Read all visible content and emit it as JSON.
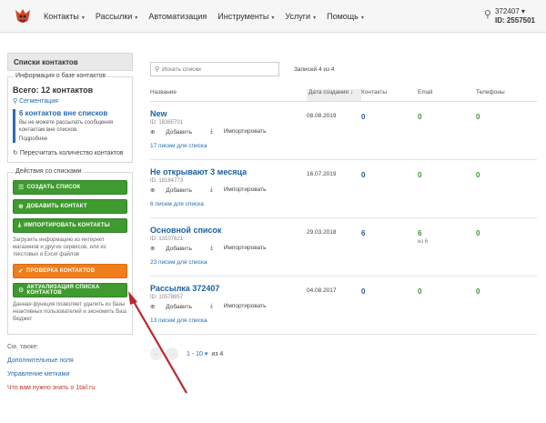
{
  "topnav": {
    "items": [
      {
        "label": "Контакты",
        "caret": "▾"
      },
      {
        "label": "Рассылки",
        "caret": "▾"
      },
      {
        "label": "Автоматизация",
        "caret": ""
      },
      {
        "label": "Инструменты",
        "caret": "▾"
      },
      {
        "label": "Услуги",
        "caret": "▾"
      },
      {
        "label": "Помощь",
        "caret": "▾"
      }
    ],
    "account": {
      "user": "372407",
      "id": "ID: 2557501"
    }
  },
  "sidebar": {
    "title": "Списки контактов",
    "info_legend": "Информация о базе контактов",
    "total": "Всего: 12 контактов",
    "segmentation": "Сегментация",
    "notice_title": "6 контактов вне списков",
    "notice_text": "Вы не можете рассылать сообщения контактам вне списков.",
    "notice_more": "Подробнее",
    "recount": "Пересчитать количество контактов",
    "actions_legend": "Действия со списками",
    "btn_create": "СОЗДАТЬ СПИСОК",
    "btn_add": "ДОБАВИТЬ КОНТАКТ",
    "btn_import": "ИМПОРТИРОВАТЬ КОНТАКТЫ",
    "import_desc": "Загрузить информацию из интернет магазинов и других сервисов, или из текстовых и Excel файлов",
    "btn_check": "ПРОВЕРКА КОНТАКТОВ",
    "btn_actualize": "АКТУАЛИЗАЦИЯ СПИСКА КОНТАКТОВ",
    "actualize_desc": "Данная функция позволяет удалить из базы неактивных пользователей и экономить Ваш бюджет",
    "see_also": "См. также:",
    "links": [
      "Дополнительные поля",
      "Управление метками",
      "Что вам нужно знать о 1tail.ru"
    ]
  },
  "main": {
    "search_placeholder": "Искать списки",
    "records": "Записей 4 из 4",
    "headers": {
      "name": "Название",
      "date": "Дата создания ↓",
      "contacts": "Контакты",
      "email": "Email",
      "phones": "Телефоны"
    },
    "add_label": "Добавить",
    "import_label": "Импортировать",
    "rows": [
      {
        "name": "New",
        "id": "ID: 18365701",
        "sent": "17 писем для списка",
        "date": "08.08.2019",
        "contacts": "0",
        "email": "0",
        "email_sub": "",
        "phones": "0"
      },
      {
        "name": "Не открывают 3 месяца",
        "id": "ID: 18184773",
        "sent": "6 писем для списка",
        "date": "16.07.2019",
        "contacts": "0",
        "email": "0",
        "email_sub": "",
        "phones": "0"
      },
      {
        "name": "Основной список",
        "id": "ID: 13107621",
        "sent": "23 писем для списка",
        "date": "29.03.2018",
        "contacts": "6",
        "email": "6",
        "email_sub": "из 6",
        "phones": "0"
      },
      {
        "name": "Рассылка 372407",
        "id": "ID: 10578857",
        "sent": "13 писем для списка",
        "date": "04.08.2017",
        "contacts": "0",
        "email": "0",
        "email_sub": "",
        "phones": "0"
      }
    ],
    "pager": {
      "range": "1 - 10 ▾",
      "of": "из 4"
    }
  },
  "colors": {
    "accent": "#2a6cb0",
    "green": "#3f9a2f",
    "orange": "#f07d1c",
    "arrow": "#b8282d"
  }
}
